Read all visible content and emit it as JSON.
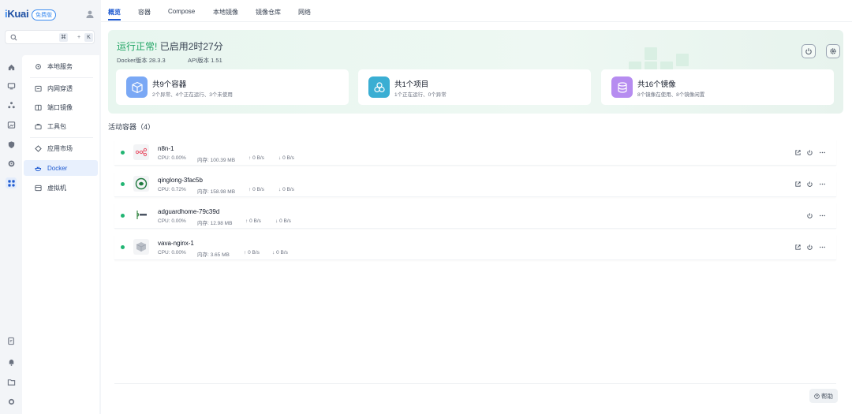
{
  "brand": {
    "name_i": "i",
    "name_rest": "Kuai",
    "edition": "免费版"
  },
  "search": {
    "key1": "⌘",
    "plus": "+",
    "key2": "K"
  },
  "sidebar": {
    "items": [
      {
        "label": "本地服务",
        "icon": "gear-network-icon"
      },
      {
        "label": "内网穿透",
        "icon": "tunnel-icon"
      },
      {
        "label": "端口镜像",
        "icon": "mirror-icon"
      },
      {
        "label": "工具包",
        "icon": "toolbox-icon"
      },
      {
        "label": "应用市场",
        "icon": "market-icon"
      },
      {
        "label": "Docker",
        "icon": "docker-icon"
      },
      {
        "label": "虚拟机",
        "icon": "vm-icon"
      }
    ],
    "active": "Docker"
  },
  "tabs": [
    "概览",
    "容器",
    "Compose",
    "本地镜像",
    "镜像仓库",
    "网络"
  ],
  "banner": {
    "status": "运行正常!",
    "uptime": "已启用2时27分",
    "docker_version": "Docker版本 28.3.3",
    "api_version": "API版本 1.51",
    "colors": {
      "ok": "#1fa463"
    }
  },
  "cards": [
    {
      "title": "共9个容器",
      "sub": "2个异常、4个正在运行、3个未使用",
      "icon": "cube-icon",
      "color": "#7aa8f5"
    },
    {
      "title": "共1个项目",
      "sub": "1个正在运行、0个异常",
      "icon": "cluster-icon",
      "color": "#3aaed3"
    },
    {
      "title": "共16个镜像",
      "sub": "8个镜像在使用、8个镜像闲置",
      "icon": "database-icon",
      "color": "#b68cf0"
    }
  ],
  "section": {
    "title": "活动容器（4）"
  },
  "containers": [
    {
      "name": "n8n-1",
      "cpu": "CPU: 0.00%",
      "mem": "内存: 100.39 MB",
      "up": "0 B/s",
      "down": "0 B/s",
      "logo": "n8n-logo-icon",
      "edit": true
    },
    {
      "name": "qinglong-3fac5b",
      "cpu": "CPU: 0.72%",
      "mem": "内存: 158.98 MB",
      "up": "0 B/s",
      "down": "0 B/s",
      "logo": "qinglong-logo-icon",
      "edit": true
    },
    {
      "name": "adguardhome-79c39d",
      "cpu": "CPU: 0.00%",
      "mem": "内存: 12.98 MB",
      "up": "0 B/s",
      "down": "0 B/s",
      "logo": "adguard-logo-icon",
      "edit": false
    },
    {
      "name": "vava-nginx-1",
      "cpu": "CPU: 0.00%",
      "mem": "内存: 3.65 MB",
      "up": "0 B/s",
      "down": "0 B/s",
      "logo": "box-logo-icon",
      "edit": true
    }
  ],
  "footer": {
    "help": "帮助"
  }
}
